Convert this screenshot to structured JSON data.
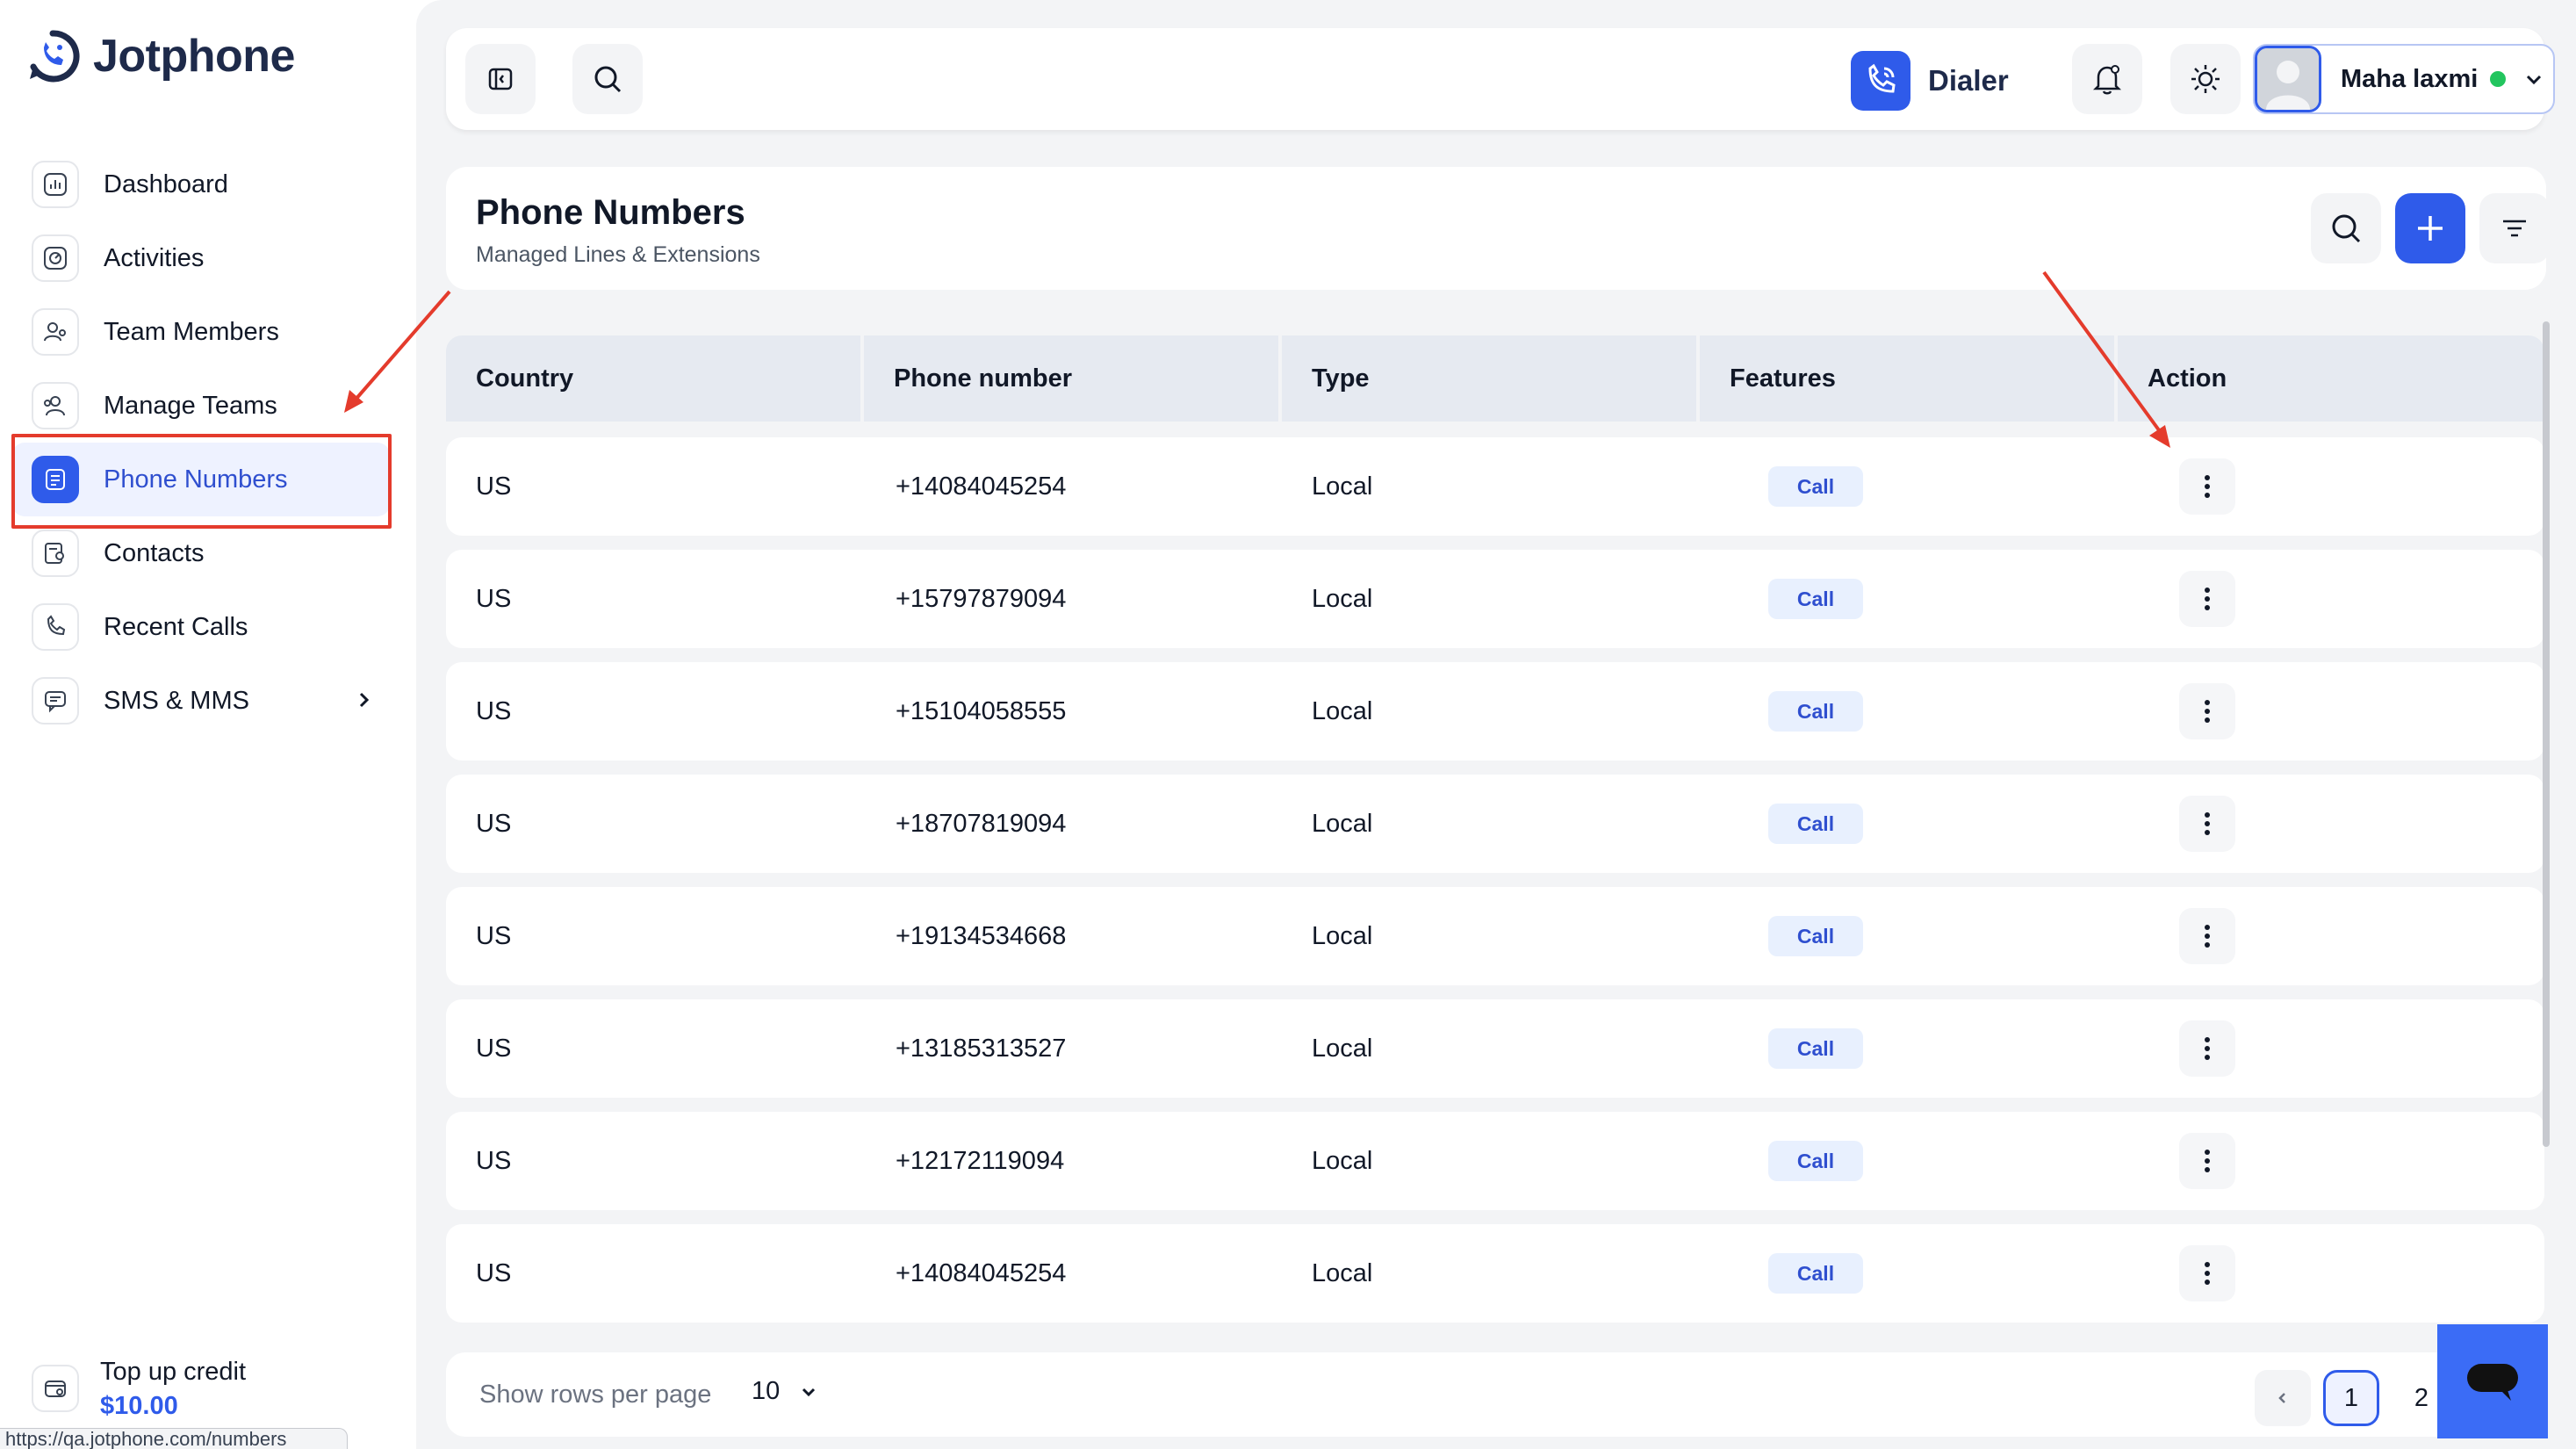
{
  "app": {
    "name": "Jotphone"
  },
  "sidebar": {
    "items": [
      {
        "label": "Dashboard",
        "icon": "chart-icon"
      },
      {
        "label": "Activities",
        "icon": "activity-icon"
      },
      {
        "label": "Team Members",
        "icon": "user-group-icon"
      },
      {
        "label": "Manage Teams",
        "icon": "team-icon"
      },
      {
        "label": "Phone Numbers",
        "icon": "phone-book-icon",
        "active": true
      },
      {
        "label": "Contacts",
        "icon": "contacts-icon"
      },
      {
        "label": "Recent Calls",
        "icon": "recent-calls-icon"
      },
      {
        "label": "SMS & MMS",
        "icon": "message-icon",
        "has_submenu": true
      }
    ],
    "topup": {
      "title": "Top up credit",
      "amount": "$10.00"
    },
    "status_url": "https://qa.jotphone.com/numbers"
  },
  "topbar": {
    "dialer_label": "Dialer",
    "user_name": "Maha laxmi",
    "user_status_color": "#22c55e"
  },
  "page": {
    "title": "Phone Numbers",
    "subtitle": "Managed Lines & Extensions"
  },
  "table": {
    "columns": [
      "Country",
      "Phone number",
      "Type",
      "Features",
      "Action"
    ],
    "rows": [
      {
        "country": "US",
        "phone": "+14084045254",
        "type": "Local",
        "feature": "Call"
      },
      {
        "country": "US",
        "phone": "+15797879094",
        "type": "Local",
        "feature": "Call"
      },
      {
        "country": "US",
        "phone": "+15104058555",
        "type": "Local",
        "feature": "Call"
      },
      {
        "country": "US",
        "phone": "+18707819094",
        "type": "Local",
        "feature": "Call"
      },
      {
        "country": "US",
        "phone": "+19134534668",
        "type": "Local",
        "feature": "Call"
      },
      {
        "country": "US",
        "phone": "+13185313527",
        "type": "Local",
        "feature": "Call"
      },
      {
        "country": "US",
        "phone": "+12172119094",
        "type": "Local",
        "feature": "Call"
      },
      {
        "country": "US",
        "phone": "+14084045254",
        "type": "Local",
        "feature": "Call"
      }
    ]
  },
  "pagination": {
    "rows_label": "Show rows per page",
    "rows_value": "10",
    "pages": [
      "1",
      "2"
    ],
    "current_page": "1"
  },
  "colors": {
    "accent": "#2f5bea",
    "annotation": "#e43b2c"
  }
}
